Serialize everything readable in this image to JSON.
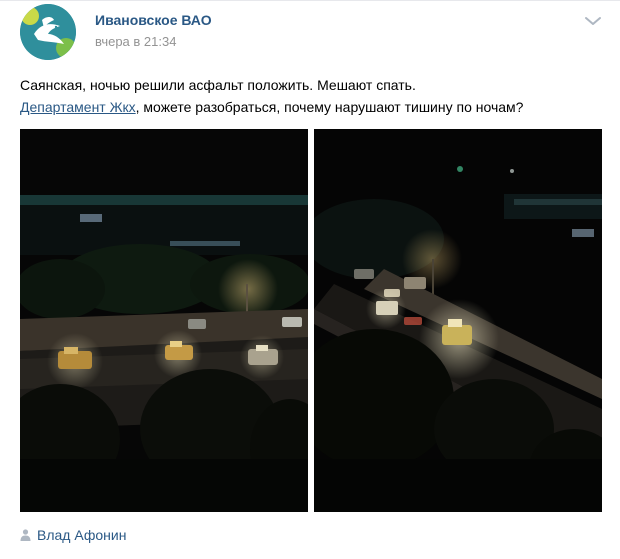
{
  "post": {
    "author": "Ивановское ВАО",
    "time": "вчера в 21:34",
    "text_line1": "Саянская, ночью решили асфальт положить. Мешают спать.",
    "mention": "Департамент Жкх",
    "text_line2_rest": ", можете разобраться, почему нарушают тишину по ночам?",
    "signer": "Влад Афонин"
  },
  "icons": {
    "avatar": "bird-dove-logo",
    "menu": "chevron-down-icon",
    "signer": "person-icon"
  },
  "colors": {
    "link": "#2a5885",
    "meta": "#939393",
    "avatar_bg": "#2f8f9c"
  }
}
